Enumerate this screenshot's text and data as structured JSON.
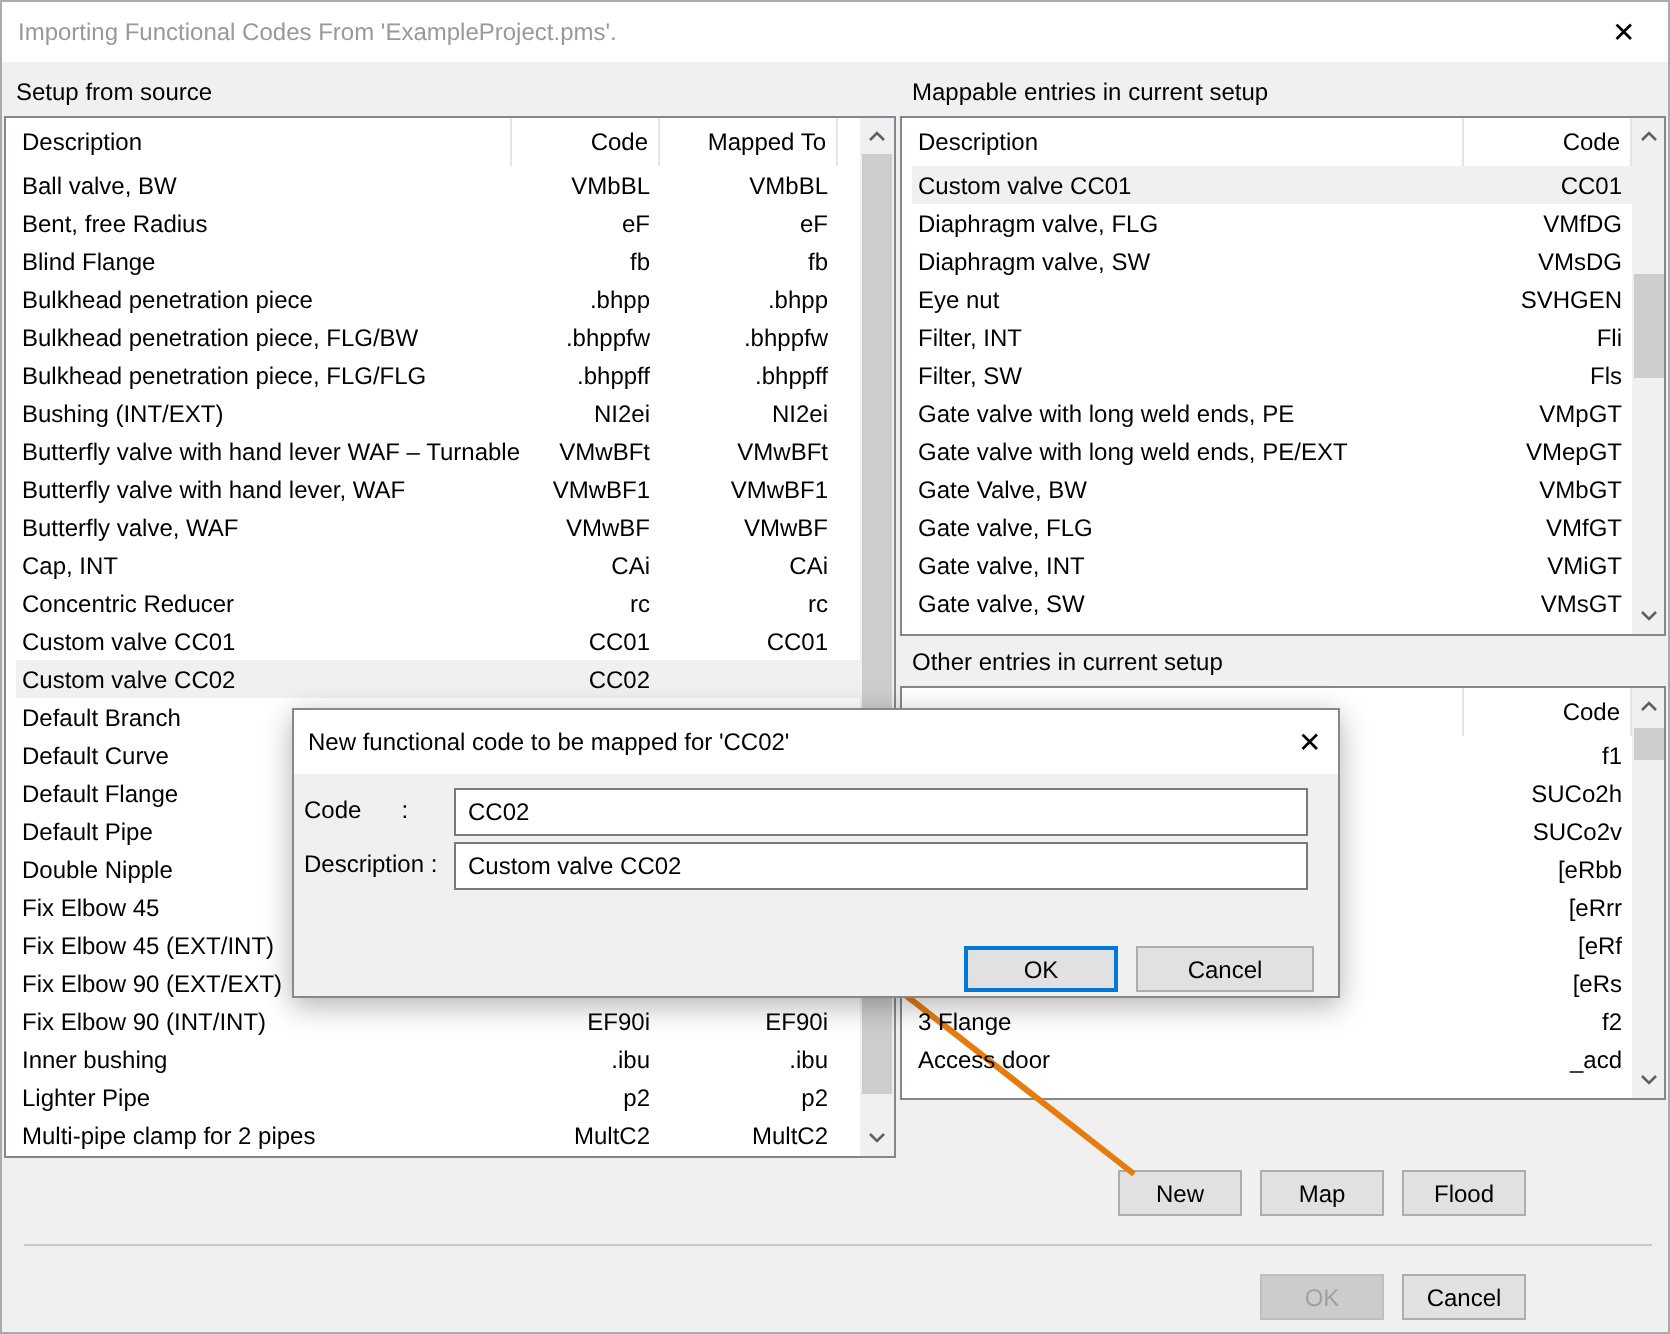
{
  "window": {
    "title": "Importing Functional Codes From 'ExampleProject.pms'.",
    "close": "✕"
  },
  "source": {
    "heading": "Setup from source",
    "columns": [
      {
        "label": "Description"
      },
      {
        "label": "Code"
      },
      {
        "label": "Mapped To"
      }
    ],
    "rows": [
      {
        "cells": [
          "Ball valve, BW",
          "VMbBL",
          "VMbBL"
        ],
        "selected": false
      },
      {
        "cells": [
          "Bent, free Radius",
          "eF",
          "eF"
        ],
        "selected": false
      },
      {
        "cells": [
          "Blind Flange",
          "fb",
          "fb"
        ],
        "selected": false
      },
      {
        "cells": [
          "Bulkhead penetration piece",
          ".bhpp",
          ".bhpp"
        ],
        "selected": false
      },
      {
        "cells": [
          "Bulkhead penetration piece, FLG/BW",
          ".bhppfw",
          ".bhppfw"
        ],
        "selected": false
      },
      {
        "cells": [
          "Bulkhead penetration piece, FLG/FLG",
          ".bhppff",
          ".bhppff"
        ],
        "selected": false
      },
      {
        "cells": [
          "Bushing (INT/EXT)",
          "NI2ei",
          "NI2ei"
        ],
        "selected": false
      },
      {
        "cells": [
          "Butterfly valve with hand lever WAF – Turnable",
          "VMwBFt",
          "VMwBFt"
        ],
        "selected": false
      },
      {
        "cells": [
          "Butterfly valve with hand lever, WAF",
          "VMwBF1",
          "VMwBF1"
        ],
        "selected": false
      },
      {
        "cells": [
          "Butterfly valve, WAF",
          "VMwBF",
          "VMwBF"
        ],
        "selected": false
      },
      {
        "cells": [
          "Cap, INT",
          "CAi",
          "CAi"
        ],
        "selected": false
      },
      {
        "cells": [
          "Concentric Reducer",
          "rc",
          "rc"
        ],
        "selected": false
      },
      {
        "cells": [
          "Custom valve CC01",
          "CC01",
          "CC01"
        ],
        "selected": false
      },
      {
        "cells": [
          "Custom valve CC02",
          "CC02",
          null
        ],
        "selected": true
      },
      {
        "cells": [
          "Default Branch",
          null,
          null
        ],
        "selected": false
      },
      {
        "cells": [
          "Default Curve",
          null,
          null
        ],
        "selected": false
      },
      {
        "cells": [
          "Default Flange",
          null,
          null
        ],
        "selected": false
      },
      {
        "cells": [
          "Default Pipe",
          null,
          null
        ],
        "selected": false
      },
      {
        "cells": [
          "Double Nipple",
          null,
          null
        ],
        "selected": false
      },
      {
        "cells": [
          "Fix Elbow 45",
          null,
          null
        ],
        "selected": false
      },
      {
        "cells": [
          "Fix Elbow 45 (EXT/INT)",
          null,
          null
        ],
        "selected": false
      },
      {
        "cells": [
          "Fix Elbow 90 (EXT/EXT)",
          null,
          null
        ],
        "selected": false
      },
      {
        "cells": [
          "Fix Elbow 90 (INT/INT)",
          "EF90i",
          "EF90i"
        ],
        "selected": false
      },
      {
        "cells": [
          "Inner bushing",
          ".ibu",
          ".ibu"
        ],
        "selected": false
      },
      {
        "cells": [
          "Lighter Pipe",
          "p2",
          "p2"
        ],
        "selected": false
      },
      {
        "cells": [
          "Multi-pipe clamp for 2 pipes",
          "MultC2",
          "MultC2"
        ],
        "selected": false
      }
    ]
  },
  "mappable": {
    "heading": "Mappable entries in current setup",
    "columns": [
      {
        "label": "Description"
      },
      {
        "label": "Code"
      }
    ],
    "rows": [
      {
        "cells": [
          "Custom valve CC01",
          "CC01"
        ],
        "selected": true
      },
      {
        "cells": [
          "Diaphragm valve, FLG",
          "VMfDG"
        ],
        "selected": false
      },
      {
        "cells": [
          "Diaphragm valve, SW",
          "VMsDG"
        ],
        "selected": false
      },
      {
        "cells": [
          "Eye nut",
          "SVHGEN"
        ],
        "selected": false
      },
      {
        "cells": [
          "Filter, INT",
          "Fli"
        ],
        "selected": false
      },
      {
        "cells": [
          "Filter, SW",
          "Fls"
        ],
        "selected": false
      },
      {
        "cells": [
          "Gate valve with long weld ends, PE",
          "VMpGT"
        ],
        "selected": false
      },
      {
        "cells": [
          "Gate valve with long weld ends, PE/EXT",
          "VMepGT"
        ],
        "selected": false
      },
      {
        "cells": [
          "Gate Valve, BW",
          "VMbGT"
        ],
        "selected": false
      },
      {
        "cells": [
          "Gate valve, FLG",
          "VMfGT"
        ],
        "selected": false
      },
      {
        "cells": [
          "Gate valve, INT",
          "VMiGT"
        ],
        "selected": false
      },
      {
        "cells": [
          "Gate valve, SW",
          "VMsGT"
        ],
        "selected": false
      }
    ]
  },
  "other": {
    "heading": "Other entries in current setup",
    "columns": [
      {},
      {
        "label": "Code"
      }
    ],
    "rows": [
      {
        "cells": [
          null,
          "f1"
        ],
        "selected": false
      },
      {
        "cells": [
          null,
          "SUCo2h"
        ],
        "selected": false
      },
      {
        "cells": [
          null,
          "SUCo2v"
        ],
        "selected": false
      },
      {
        "cells": [
          null,
          "[eRbb"
        ],
        "selected": false
      },
      {
        "cells": [
          null,
          "[eRrr"
        ],
        "selected": false
      },
      {
        "cells": [
          null,
          "[eRf"
        ],
        "selected": false
      },
      {
        "cells": [
          null,
          "[eRs"
        ],
        "selected": false
      },
      {
        "cells": [
          "3 Flange",
          "f2"
        ],
        "selected": false
      },
      {
        "cells": [
          "Access door",
          "_acd"
        ],
        "selected": false
      }
    ]
  },
  "actions": [
    {
      "label": "New",
      "disabled": false
    },
    {
      "label": "Map",
      "disabled": false
    },
    {
      "label": "Flood",
      "disabled": false
    }
  ],
  "footer_buttons": [
    {
      "label": "OK",
      "disabled": true
    },
    {
      "label": "Cancel",
      "disabled": false
    }
  ],
  "dialog": {
    "title": "New functional code to be mapped for 'CC02'",
    "close": "✕",
    "fields": [
      {
        "label": "Code",
        "colon": ":",
        "value": "CC02"
      },
      {
        "label": "Description",
        "colon": ":",
        "value": "Custom valve CC02"
      }
    ],
    "buttons": [
      {
        "label": "OK",
        "default": true
      },
      {
        "label": "Cancel",
        "default": false
      }
    ]
  }
}
